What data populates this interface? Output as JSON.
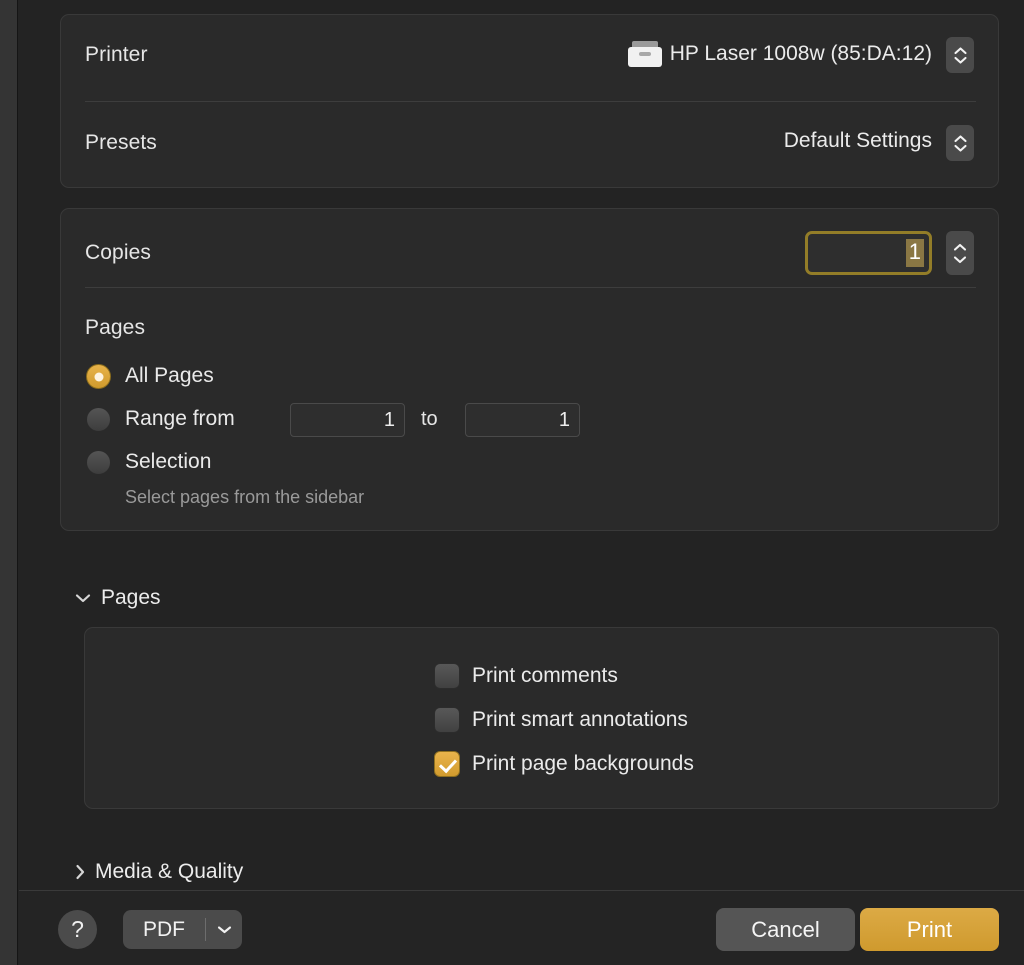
{
  "dialog": {
    "printer_row": {
      "label": "Printer",
      "value": "HP Laser 1008w (85:DA:12)",
      "icon": "printer-icon"
    },
    "presets_row": {
      "label": "Presets",
      "value": "Default Settings"
    },
    "copies_row": {
      "label": "Copies",
      "value": "1"
    },
    "pages_group": {
      "label": "Pages",
      "options": [
        {
          "label": "All Pages",
          "selected": true
        },
        {
          "label": "Range from",
          "selected": false
        },
        {
          "label": "Selection",
          "selected": false
        }
      ],
      "range_from": "1",
      "range_to": "1",
      "to_label": "to",
      "selection_hint": "Select pages from the sidebar"
    },
    "sections": [
      {
        "title": "Pages",
        "expanded": true,
        "chevron": "chevron-down-icon",
        "checkboxes": [
          {
            "label": "Print comments",
            "checked": false
          },
          {
            "label": "Print smart annotations",
            "checked": false
          },
          {
            "label": "Print page backgrounds",
            "checked": true
          }
        ]
      },
      {
        "title": "Media & Quality",
        "expanded": false,
        "chevron": "chevron-right-icon"
      }
    ],
    "footer": {
      "help_label": "?",
      "pdf_label": "PDF",
      "cancel_label": "Cancel",
      "print_label": "Print"
    },
    "colors": {
      "accent": "#d29b2e",
      "focus_ring": "#937d28",
      "selection": "#8a7744",
      "panel_bg": "#2a2a2a",
      "window_bg": "#232323"
    }
  }
}
